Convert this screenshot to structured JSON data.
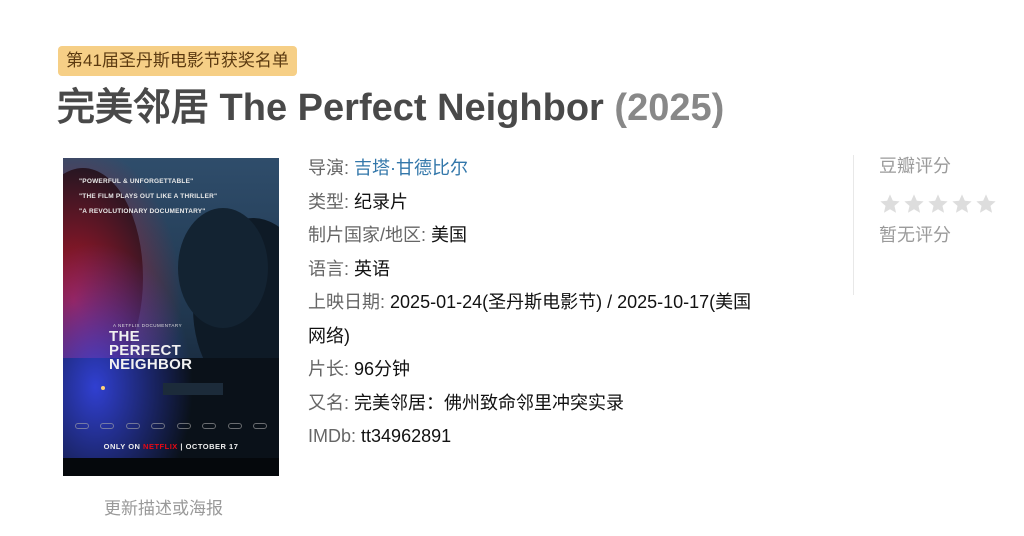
{
  "award_badge": "第41届圣丹斯电影节获奖名单",
  "title": {
    "name": "完美邻居 The Perfect Neighbor",
    "year": "(2025)"
  },
  "poster": {
    "quotes": [
      "\"POWERFUL & UNFORGETTABLE\"",
      "\"THE FILM PLAYS OUT LIKE A THRILLER\"",
      "\"A REVOLUTIONARY DOCUMENTARY\""
    ],
    "presents": "A NETFLIX DOCUMENTARY",
    "title_line1": "THE",
    "title_line2": "PERFECT",
    "title_line3": "NEIGHBOR",
    "bottom_prefix": "ONLY ON",
    "bottom_brand": "NETFLIX",
    "bottom_sep": "|",
    "bottom_date": "OCTOBER 17"
  },
  "update_link": "更新描述或海报",
  "info": {
    "director_label": "导演:",
    "director_value": "吉塔·甘德比尔",
    "genre_label": "类型:",
    "genre_value": "纪录片",
    "country_label": "制片国家/地区:",
    "country_value": "美国",
    "language_label": "语言:",
    "language_value": "英语",
    "release_label": "上映日期:",
    "release_value": "2025-01-24(圣丹斯电影节) / 2025-10-17(美国",
    "release_value_cont": "网络)",
    "runtime_label": "片长:",
    "runtime_value": "96分钟",
    "aka_label": "又名:",
    "aka_value": "完美邻居：佛州致命邻里冲突实录",
    "imdb_label": "IMDb:",
    "imdb_value": "tt34962891"
  },
  "rating": {
    "title": "豆瓣评分",
    "stars_filled": 0,
    "stars_total": 5,
    "star_color": "#dddddd",
    "status": "暂无评分"
  },
  "colors": {
    "badge_bg": "#f6cf86",
    "link": "#3377aa",
    "title": "#494949"
  }
}
